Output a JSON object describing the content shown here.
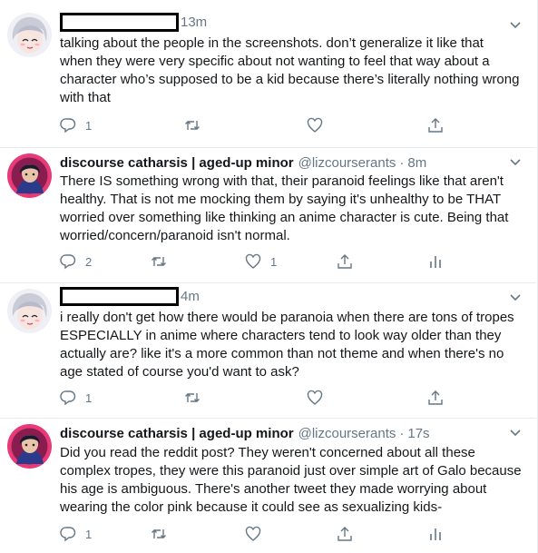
{
  "tweets": [
    {
      "author_type": "redacted",
      "time": "13m",
      "text_lines": [
        "talking about the people in the screenshots. don’t generalize it like that",
        "when they were very specific about not wanting to feel that way about a",
        "character who’s supposed to be a kid because there’s literally nothing wrong",
        "with that"
      ],
      "replies": "1",
      "retweets": "",
      "likes": ""
    },
    {
      "author_type": "named",
      "name": "discourse catharsis | aged-up minor",
      "handle": "@lizcourserants",
      "sep": "·",
      "time": "8m",
      "text_lines": [
        "There IS something wrong with that, their paranoid feelings like that aren't",
        "healthy. That is not me mocking them by saying it's unhealthy to be THAT",
        "worried over something like thinking an anime character is cute. Being that",
        "worried/concern/paranoid isn't normal."
      ],
      "replies": "2",
      "retweets": "",
      "likes": "1"
    },
    {
      "author_type": "redacted",
      "time": "4m",
      "text_lines": [
        "i really don't get how there would be paranoia when there are tons of tropes",
        "ESPECIALLY in anime where characters tend to look way older than they",
        "actually are? like it's a more common than not theme and when there's no",
        "age stated of course you'd want to ask?"
      ],
      "replies": "1",
      "retweets": "",
      "likes": ""
    },
    {
      "author_type": "named",
      "name": "discourse catharsis | aged-up minor",
      "handle": "@lizcourserants",
      "sep": "·",
      "time": "17s",
      "text_lines": [
        "Did you read the reddit post? They weren't concerned about all these",
        "complex tropes, they were this paranoid just over simple art of Galo because",
        "his age is ambiguous. There's another tweet they made worrying about",
        "wearing the color pink because it could see as sexualizing kids-"
      ],
      "replies": "1",
      "retweets": "",
      "likes": ""
    }
  ],
  "colors": {
    "text": "#14171a",
    "muted": "#657786",
    "border": "#e6ecf0",
    "redaction": "#000000"
  },
  "icons": [
    "chevron-down-icon",
    "reply-icon",
    "retweet-icon",
    "like-icon",
    "share-icon",
    "analytics-icon"
  ]
}
